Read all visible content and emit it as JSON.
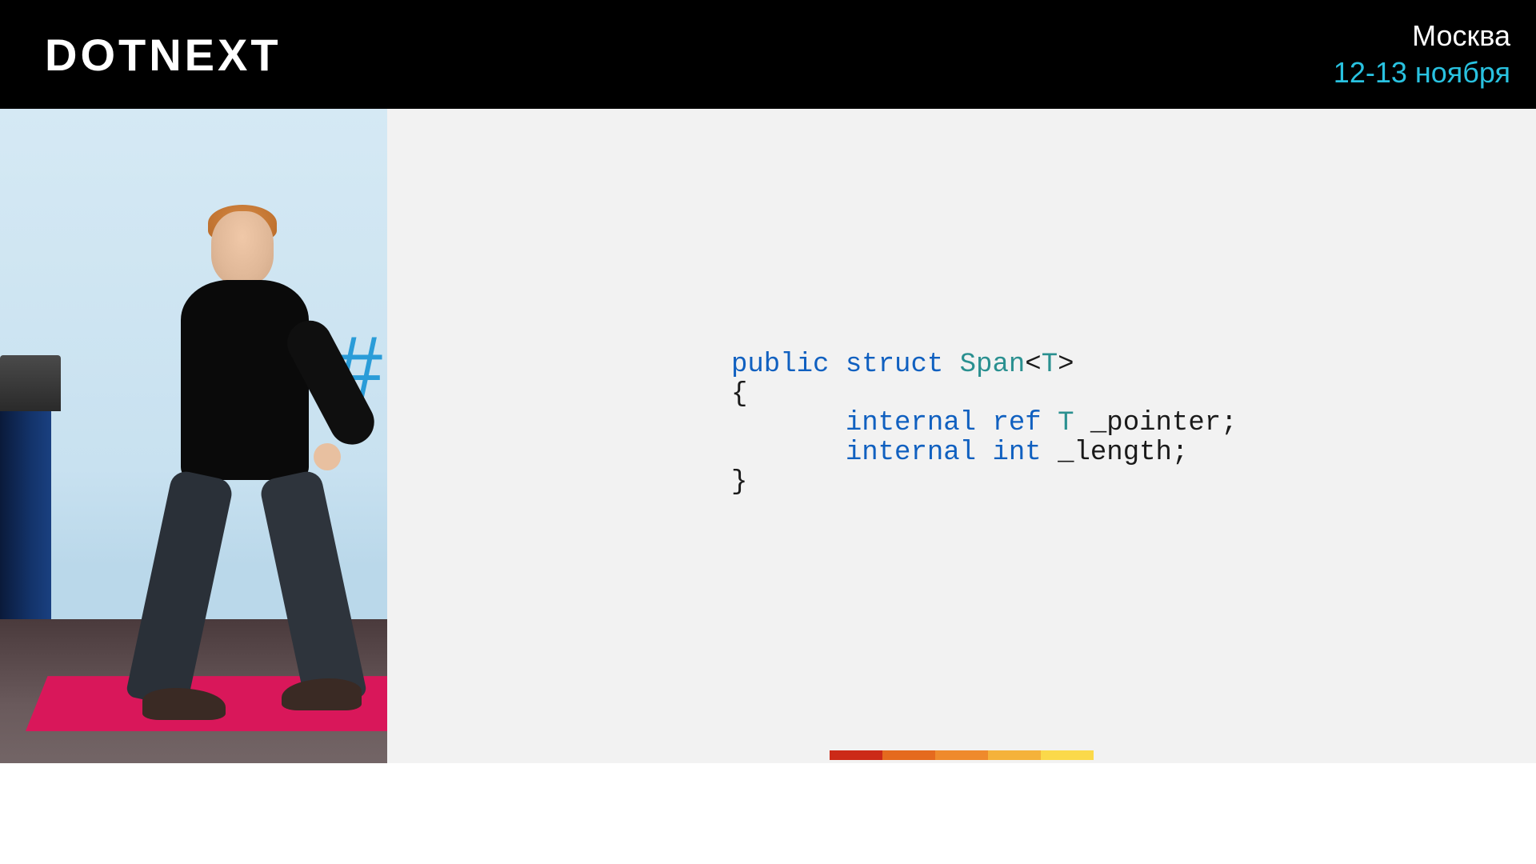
{
  "header": {
    "logo": "DOTNEXT",
    "city": "Москва",
    "date": "12-13 ноября"
  },
  "video": {
    "hashtag": "#"
  },
  "slide": {
    "code": {
      "l1_kw1": "public",
      "l1_kw2": "struct",
      "l1_type": "Span",
      "l1_open_angle": "<",
      "l1_generic": "T",
      "l1_close_angle": ">",
      "l2_brace_open": "{",
      "l3_kw1": "internal",
      "l3_kw2": "ref",
      "l3_type": "T",
      "l3_ident": "_pointer;",
      "l4_kw1": "internal",
      "l4_kw2": "int",
      "l4_ident": "_length;",
      "l5_brace_close": "}"
    },
    "accent_colors": [
      "#cc2a18",
      "#e56a1e",
      "#ef8a2c",
      "#f5b23a",
      "#fbd94a"
    ]
  }
}
